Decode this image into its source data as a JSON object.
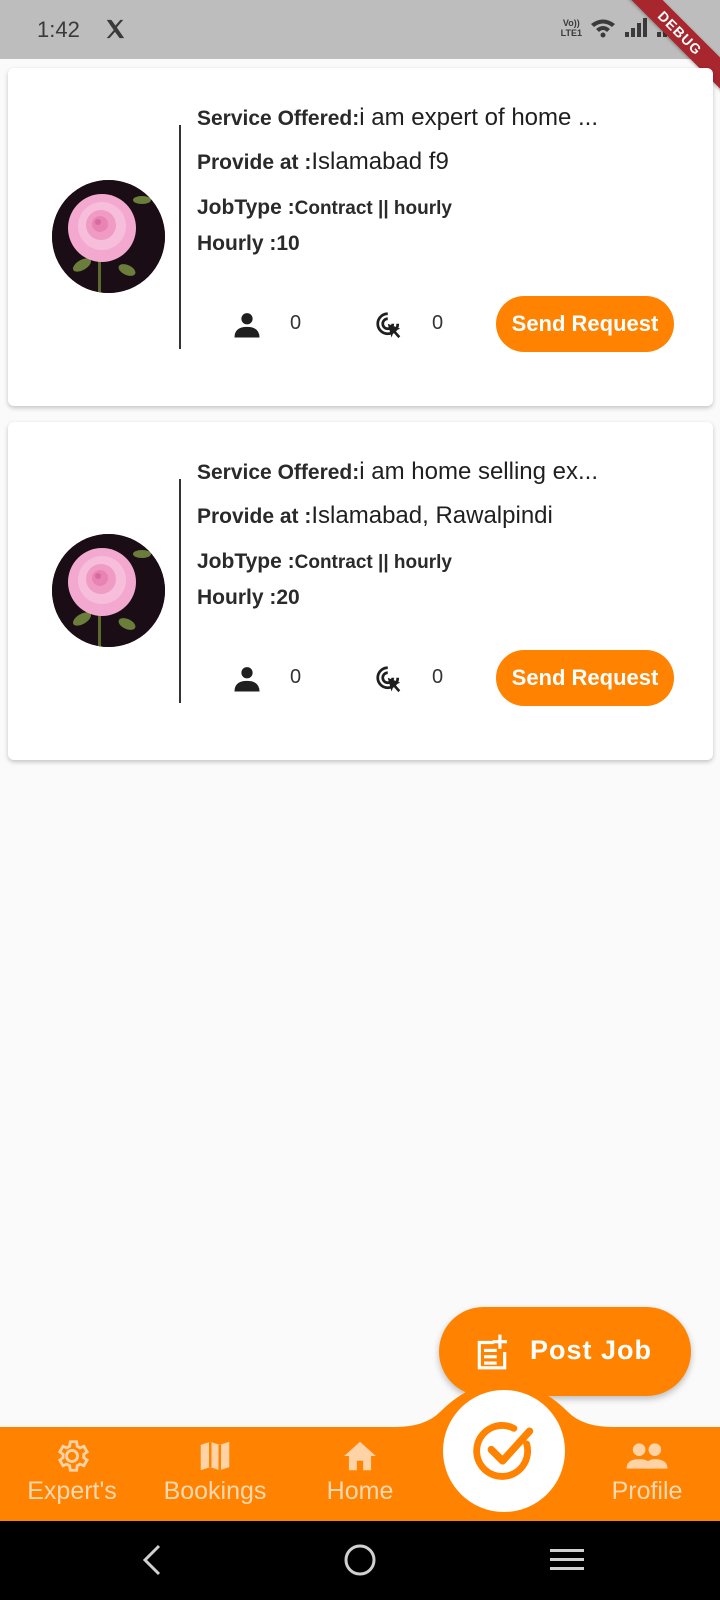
{
  "status_bar": {
    "time": "1:42",
    "volte_top": "Vo))",
    "volte_bottom": "LTE1",
    "debug": "DEBUG"
  },
  "cards": [
    {
      "service_label": "Service Offered:",
      "service_value": "i am expert of home ...",
      "provide_label": "Provide at :",
      "provide_value": "Islamabad f9",
      "jobtype_label": "JobType :",
      "jobtype_value": "Contract  || hourly",
      "hourly_label": "Hourly :",
      "hourly_value": "10",
      "persons_count": "0",
      "clicks_count": "0",
      "button_label": "Send Request"
    },
    {
      "service_label": "Service Offered:",
      "service_value": "i am home selling ex...",
      "provide_label": "Provide at :",
      "provide_value": "Islamabad, Rawalpindi",
      "jobtype_label": "JobType :",
      "jobtype_value": "Contract  || hourly",
      "hourly_label": "Hourly :",
      "hourly_value": "20",
      "persons_count": "0",
      "clicks_count": "0",
      "button_label": "Send Request"
    }
  ],
  "fab": {
    "label": "Post Job",
    "icon": "post-add-icon"
  },
  "bottom_nav": {
    "items": [
      {
        "label": "Expert's",
        "icon": "gear-icon"
      },
      {
        "label": "Bookings",
        "icon": "map-icon"
      },
      {
        "label": "Home",
        "icon": "home-icon"
      },
      {
        "label": "Profile",
        "icon": "people-icon"
      }
    ],
    "center_icon": "check-circle-icon"
  },
  "colors": {
    "accent": "#ff8300",
    "status_bar": "#bdbdbd",
    "background": "#fafafa",
    "debug_ribbon": "#a8262e"
  }
}
